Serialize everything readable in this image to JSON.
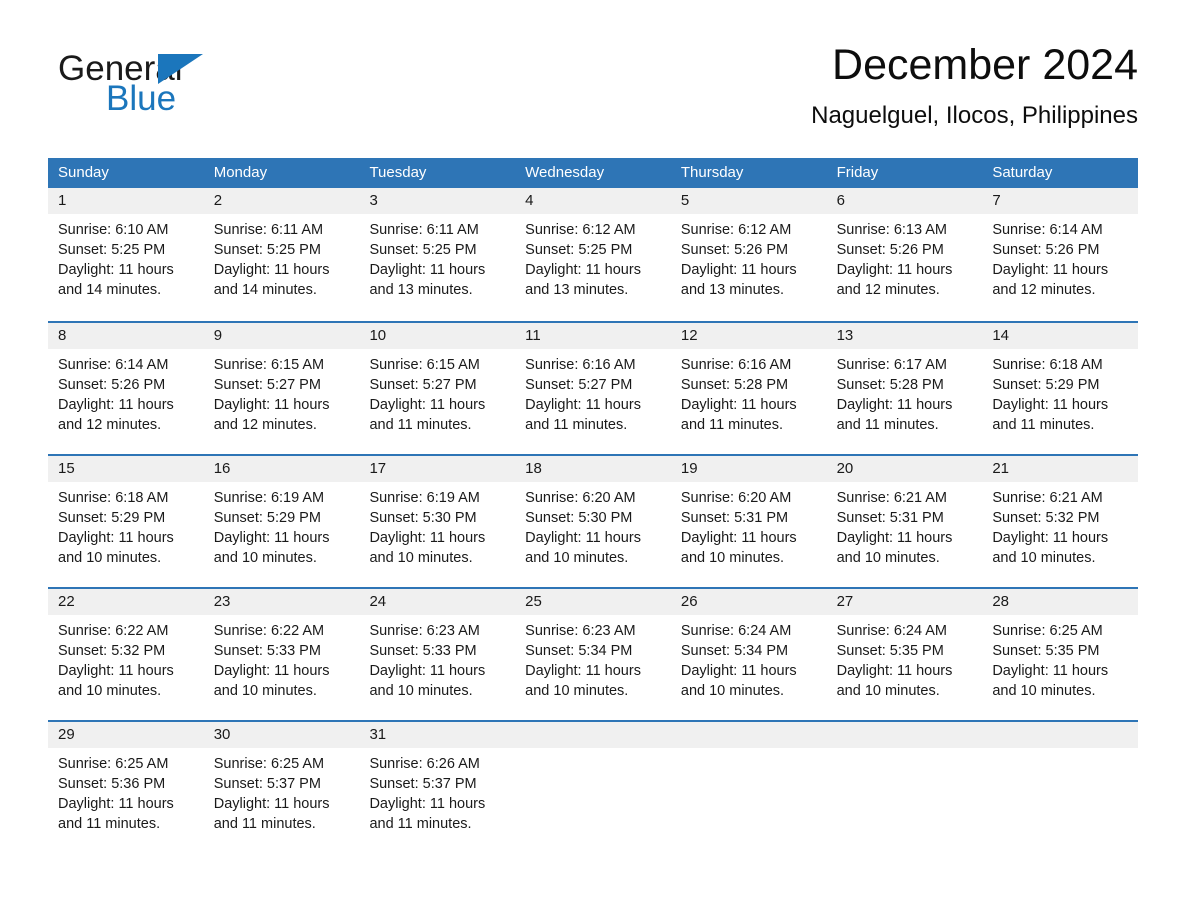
{
  "brand": {
    "name_part1": "General",
    "name_part2": "Blue",
    "flag_icon": "triangle-flag-icon",
    "accent_color": "#1b76bc"
  },
  "header": {
    "title": "December 2024",
    "location": "Naguelguel, Ilocos, Philippines"
  },
  "calendar": {
    "header_color": "#2e75b6",
    "daynum_bg_color": "#f0f0f0",
    "weekdays": [
      "Sunday",
      "Monday",
      "Tuesday",
      "Wednesday",
      "Thursday",
      "Friday",
      "Saturday"
    ],
    "weeks": [
      [
        {
          "day": "1",
          "sunrise": "Sunrise: 6:10 AM",
          "sunset": "Sunset: 5:25 PM",
          "daylight": "Daylight: 11 hours and 14 minutes."
        },
        {
          "day": "2",
          "sunrise": "Sunrise: 6:11 AM",
          "sunset": "Sunset: 5:25 PM",
          "daylight": "Daylight: 11 hours and 14 minutes."
        },
        {
          "day": "3",
          "sunrise": "Sunrise: 6:11 AM",
          "sunset": "Sunset: 5:25 PM",
          "daylight": "Daylight: 11 hours and 13 minutes."
        },
        {
          "day": "4",
          "sunrise": "Sunrise: 6:12 AM",
          "sunset": "Sunset: 5:25 PM",
          "daylight": "Daylight: 11 hours and 13 minutes."
        },
        {
          "day": "5",
          "sunrise": "Sunrise: 6:12 AM",
          "sunset": "Sunset: 5:26 PM",
          "daylight": "Daylight: 11 hours and 13 minutes."
        },
        {
          "day": "6",
          "sunrise": "Sunrise: 6:13 AM",
          "sunset": "Sunset: 5:26 PM",
          "daylight": "Daylight: 11 hours and 12 minutes."
        },
        {
          "day": "7",
          "sunrise": "Sunrise: 6:14 AM",
          "sunset": "Sunset: 5:26 PM",
          "daylight": "Daylight: 11 hours and 12 minutes."
        }
      ],
      [
        {
          "day": "8",
          "sunrise": "Sunrise: 6:14 AM",
          "sunset": "Sunset: 5:26 PM",
          "daylight": "Daylight: 11 hours and 12 minutes."
        },
        {
          "day": "9",
          "sunrise": "Sunrise: 6:15 AM",
          "sunset": "Sunset: 5:27 PM",
          "daylight": "Daylight: 11 hours and 12 minutes."
        },
        {
          "day": "10",
          "sunrise": "Sunrise: 6:15 AM",
          "sunset": "Sunset: 5:27 PM",
          "daylight": "Daylight: 11 hours and 11 minutes."
        },
        {
          "day": "11",
          "sunrise": "Sunrise: 6:16 AM",
          "sunset": "Sunset: 5:27 PM",
          "daylight": "Daylight: 11 hours and 11 minutes."
        },
        {
          "day": "12",
          "sunrise": "Sunrise: 6:16 AM",
          "sunset": "Sunset: 5:28 PM",
          "daylight": "Daylight: 11 hours and 11 minutes."
        },
        {
          "day": "13",
          "sunrise": "Sunrise: 6:17 AM",
          "sunset": "Sunset: 5:28 PM",
          "daylight": "Daylight: 11 hours and 11 minutes."
        },
        {
          "day": "14",
          "sunrise": "Sunrise: 6:18 AM",
          "sunset": "Sunset: 5:29 PM",
          "daylight": "Daylight: 11 hours and 11 minutes."
        }
      ],
      [
        {
          "day": "15",
          "sunrise": "Sunrise: 6:18 AM",
          "sunset": "Sunset: 5:29 PM",
          "daylight": "Daylight: 11 hours and 10 minutes."
        },
        {
          "day": "16",
          "sunrise": "Sunrise: 6:19 AM",
          "sunset": "Sunset: 5:29 PM",
          "daylight": "Daylight: 11 hours and 10 minutes."
        },
        {
          "day": "17",
          "sunrise": "Sunrise: 6:19 AM",
          "sunset": "Sunset: 5:30 PM",
          "daylight": "Daylight: 11 hours and 10 minutes."
        },
        {
          "day": "18",
          "sunrise": "Sunrise: 6:20 AM",
          "sunset": "Sunset: 5:30 PM",
          "daylight": "Daylight: 11 hours and 10 minutes."
        },
        {
          "day": "19",
          "sunrise": "Sunrise: 6:20 AM",
          "sunset": "Sunset: 5:31 PM",
          "daylight": "Daylight: 11 hours and 10 minutes."
        },
        {
          "day": "20",
          "sunrise": "Sunrise: 6:21 AM",
          "sunset": "Sunset: 5:31 PM",
          "daylight": "Daylight: 11 hours and 10 minutes."
        },
        {
          "day": "21",
          "sunrise": "Sunrise: 6:21 AM",
          "sunset": "Sunset: 5:32 PM",
          "daylight": "Daylight: 11 hours and 10 minutes."
        }
      ],
      [
        {
          "day": "22",
          "sunrise": "Sunrise: 6:22 AM",
          "sunset": "Sunset: 5:32 PM",
          "daylight": "Daylight: 11 hours and 10 minutes."
        },
        {
          "day": "23",
          "sunrise": "Sunrise: 6:22 AM",
          "sunset": "Sunset: 5:33 PM",
          "daylight": "Daylight: 11 hours and 10 minutes."
        },
        {
          "day": "24",
          "sunrise": "Sunrise: 6:23 AM",
          "sunset": "Sunset: 5:33 PM",
          "daylight": "Daylight: 11 hours and 10 minutes."
        },
        {
          "day": "25",
          "sunrise": "Sunrise: 6:23 AM",
          "sunset": "Sunset: 5:34 PM",
          "daylight": "Daylight: 11 hours and 10 minutes."
        },
        {
          "day": "26",
          "sunrise": "Sunrise: 6:24 AM",
          "sunset": "Sunset: 5:34 PM",
          "daylight": "Daylight: 11 hours and 10 minutes."
        },
        {
          "day": "27",
          "sunrise": "Sunrise: 6:24 AM",
          "sunset": "Sunset: 5:35 PM",
          "daylight": "Daylight: 11 hours and 10 minutes."
        },
        {
          "day": "28",
          "sunrise": "Sunrise: 6:25 AM",
          "sunset": "Sunset: 5:35 PM",
          "daylight": "Daylight: 11 hours and 10 minutes."
        }
      ],
      [
        {
          "day": "29",
          "sunrise": "Sunrise: 6:25 AM",
          "sunset": "Sunset: 5:36 PM",
          "daylight": "Daylight: 11 hours and 11 minutes."
        },
        {
          "day": "30",
          "sunrise": "Sunrise: 6:25 AM",
          "sunset": "Sunset: 5:37 PM",
          "daylight": "Daylight: 11 hours and 11 minutes."
        },
        {
          "day": "31",
          "sunrise": "Sunrise: 6:26 AM",
          "sunset": "Sunset: 5:37 PM",
          "daylight": "Daylight: 11 hours and 11 minutes."
        },
        {
          "day": "",
          "sunrise": "",
          "sunset": "",
          "daylight": ""
        },
        {
          "day": "",
          "sunrise": "",
          "sunset": "",
          "daylight": ""
        },
        {
          "day": "",
          "sunrise": "",
          "sunset": "",
          "daylight": ""
        },
        {
          "day": "",
          "sunrise": "",
          "sunset": "",
          "daylight": ""
        }
      ]
    ]
  }
}
